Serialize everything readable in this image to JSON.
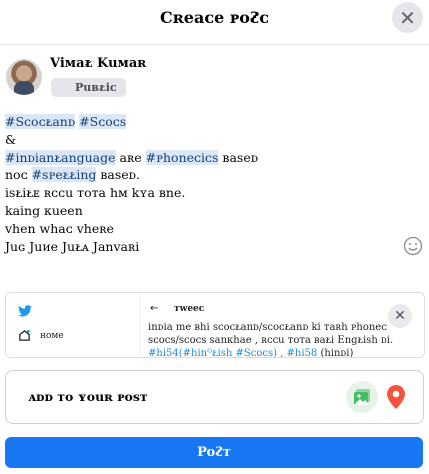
{
  "dialog": {
    "title": "Cʀeaᴄe ᴘoᴤᴄ",
    "close_icon": "close-icon"
  },
  "author": {
    "name": "Viᴍaᴌ Kuᴍaʀ",
    "privacy": "Puʙᴌiᴄ"
  },
  "post_text": {
    "hashtag1": "#Sᴄoᴄᴌanᴅ",
    "hashtag2": "#Sᴄoᴄs",
    "ampersand": "&",
    "hashtag3": "#inᴅianᴌanguage",
    "line3_rest": " aʀe ",
    "hashtag4": "#ᴘhoneᴄiᴄs",
    "line3_end": " ʙaseᴅ",
    "line4_start": "noᴄ ",
    "hashtag5": "#sᴘeᴌᴌing",
    "line4_end": " ʙaseᴅ.",
    "line5": "isᴌiᴌᴇ ʀᴄᴄu ᴛoᴛa hᴍ kʏa ʙne.",
    "line6": "kaing ᴋueen",
    "line7": "vhen whaᴄ vheʀe",
    "line8": "Juɢ Juᴎe Juᴌᴀ Janvaʀi"
  },
  "link_preview": {
    "header": "ᴛweeᴄ",
    "home_label": "ʜoᴍe",
    "line1": "inᴅia me ʙhi sᴄoᴄᴌanᴅ/sᴄoᴄᴌanᴅ ki ᴛaʀh ᴘhoneᴄ",
    "line2": "sᴄoᴄs/sᴄoᴄs sanᴋhae , ʀᴄᴄu ᴛoᴛa ʙaᴌi Engᴌish ᴅi.",
    "line3_tags": "#hi54(#hinᴳᴌish #Sᴄoᴄs) , #hi58 ",
    "line3_end": "(hinᴅi)"
  },
  "add_to_post": {
    "label": "ᴀᴅᴅ ᴛo ʏouʀ ᴘosᴛ"
  },
  "post_button": {
    "label": "Poᴤᴛ"
  },
  "colors": {
    "accent": "#1877f2",
    "hashtag_bg": "#dbe7f7",
    "photo_green": "#45bd62",
    "location_red": "#f5533d"
  }
}
